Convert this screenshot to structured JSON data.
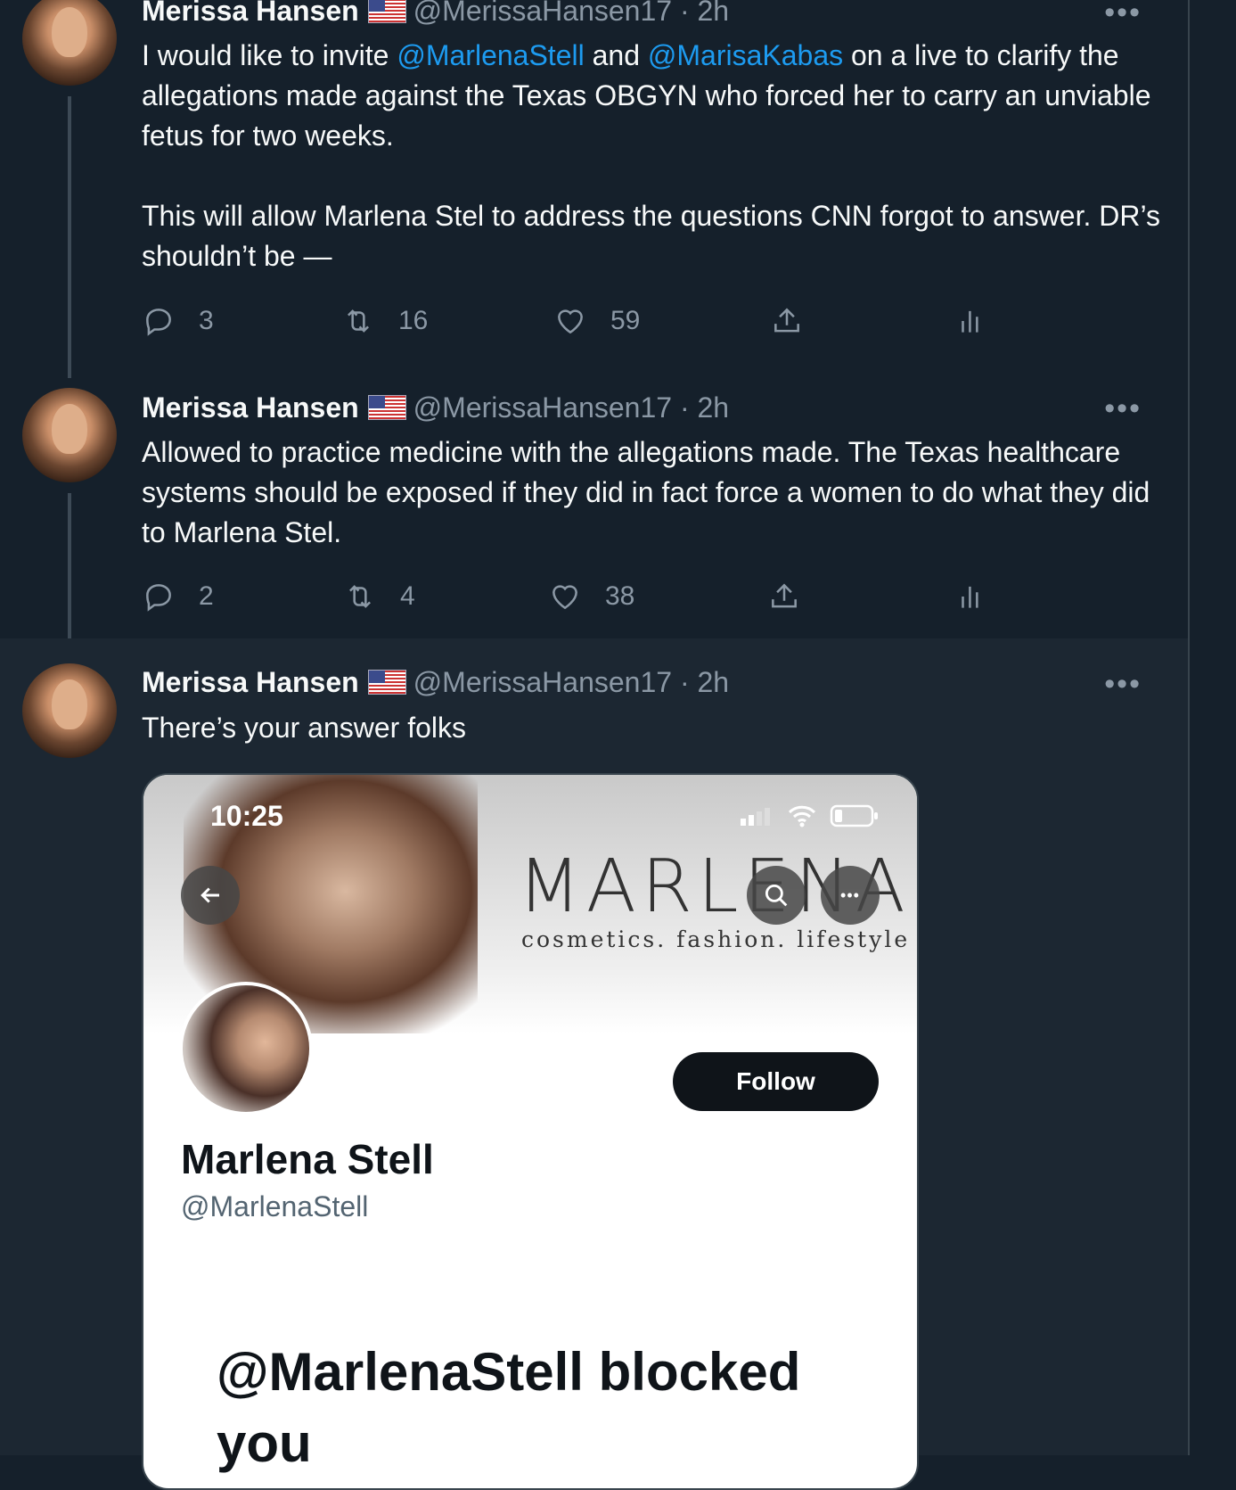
{
  "tweets": [
    {
      "name": "Merissa Hansen",
      "handle": "@MerissaHansen17",
      "time": "· 2h",
      "segments": [
        {
          "text": "I would like to invite ",
          "mention": false
        },
        {
          "text": "@MarlenaStell",
          "mention": true
        },
        {
          "text": " and ",
          "mention": false
        },
        {
          "text": "@MarisaKabas",
          "mention": true
        },
        {
          "text": " on a live to clarify the allegations made against the Texas OBGYN who forced her to carry an unviable fetus for two weeks.",
          "mention": false
        }
      ],
      "paragraph2": "This will allow Marlena Stel to address the questions CNN forgot to answer. DR’s shouldn’t be —",
      "replies": "3",
      "retweets": "16",
      "likes": "59"
    },
    {
      "name": "Merissa Hansen",
      "handle": "@MerissaHansen17",
      "time": "· 2h",
      "text": "Allowed to practice medicine with the allegations made. The Texas healthcare systems should be exposed if they did in fact force a women to do what they did to Marlena Stel.",
      "replies": "2",
      "retweets": "4",
      "likes": "38"
    },
    {
      "name": "Merissa Hansen",
      "handle": "@MerissaHansen17",
      "time": "· 2h",
      "text": "There’s your answer folks"
    }
  ],
  "media": {
    "status_time": "10:25",
    "brand": "MARLENA",
    "brand_sub": "cosmetics. fashion. lifestyle",
    "follow_label": "Follow",
    "profile_name": "Marlena Stell",
    "profile_handle": "@MarlenaStell",
    "blocked_text": "@MarlenaStell blocked you"
  },
  "more_glyph": "•••",
  "colors": {
    "background": "#15202b",
    "link": "#1d9bf0",
    "muted": "#8b98a5"
  }
}
